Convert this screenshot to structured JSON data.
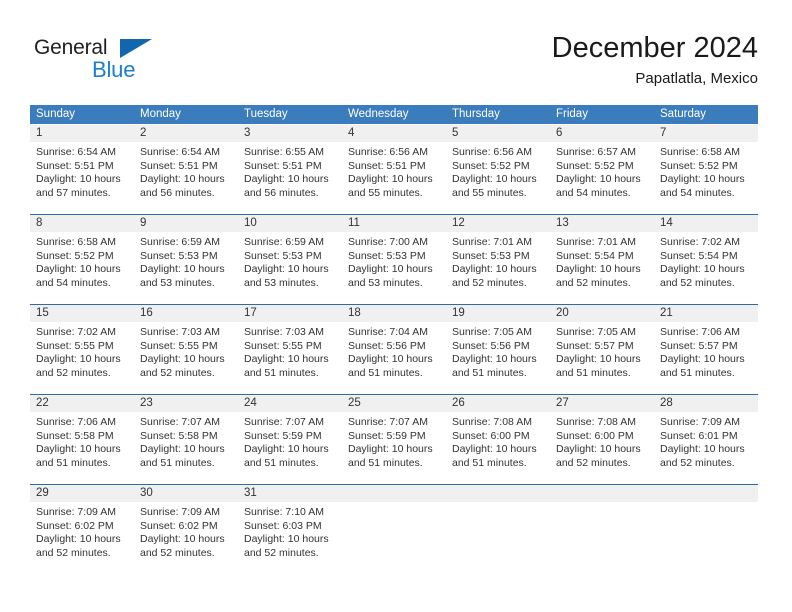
{
  "logo": {
    "word_one": "General",
    "word_two": "Blue",
    "triangle_color": "#1266ad",
    "blue_color": "#1b7fd1"
  },
  "header": {
    "title": "December 2024",
    "subtitle": "Papatlatla, Mexico"
  },
  "theme": {
    "header_blue": "#3b7cbd",
    "separator_blue": "#2d6ca8",
    "daynum_gray": "#f0f0f0"
  },
  "weekdays": [
    "Sunday",
    "Monday",
    "Tuesday",
    "Wednesday",
    "Thursday",
    "Friday",
    "Saturday"
  ],
  "weeks": [
    [
      {
        "day": "1",
        "lines": [
          "Sunrise: 6:54 AM",
          "Sunset: 5:51 PM",
          "Daylight: 10 hours",
          "and 57 minutes."
        ]
      },
      {
        "day": "2",
        "lines": [
          "Sunrise: 6:54 AM",
          "Sunset: 5:51 PM",
          "Daylight: 10 hours",
          "and 56 minutes."
        ]
      },
      {
        "day": "3",
        "lines": [
          "Sunrise: 6:55 AM",
          "Sunset: 5:51 PM",
          "Daylight: 10 hours",
          "and 56 minutes."
        ]
      },
      {
        "day": "4",
        "lines": [
          "Sunrise: 6:56 AM",
          "Sunset: 5:51 PM",
          "Daylight: 10 hours",
          "and 55 minutes."
        ]
      },
      {
        "day": "5",
        "lines": [
          "Sunrise: 6:56 AM",
          "Sunset: 5:52 PM",
          "Daylight: 10 hours",
          "and 55 minutes."
        ]
      },
      {
        "day": "6",
        "lines": [
          "Sunrise: 6:57 AM",
          "Sunset: 5:52 PM",
          "Daylight: 10 hours",
          "and 54 minutes."
        ]
      },
      {
        "day": "7",
        "lines": [
          "Sunrise: 6:58 AM",
          "Sunset: 5:52 PM",
          "Daylight: 10 hours",
          "and 54 minutes."
        ]
      }
    ],
    [
      {
        "day": "8",
        "lines": [
          "Sunrise: 6:58 AM",
          "Sunset: 5:52 PM",
          "Daylight: 10 hours",
          "and 54 minutes."
        ]
      },
      {
        "day": "9",
        "lines": [
          "Sunrise: 6:59 AM",
          "Sunset: 5:53 PM",
          "Daylight: 10 hours",
          "and 53 minutes."
        ]
      },
      {
        "day": "10",
        "lines": [
          "Sunrise: 6:59 AM",
          "Sunset: 5:53 PM",
          "Daylight: 10 hours",
          "and 53 minutes."
        ]
      },
      {
        "day": "11",
        "lines": [
          "Sunrise: 7:00 AM",
          "Sunset: 5:53 PM",
          "Daylight: 10 hours",
          "and 53 minutes."
        ]
      },
      {
        "day": "12",
        "lines": [
          "Sunrise: 7:01 AM",
          "Sunset: 5:53 PM",
          "Daylight: 10 hours",
          "and 52 minutes."
        ]
      },
      {
        "day": "13",
        "lines": [
          "Sunrise: 7:01 AM",
          "Sunset: 5:54 PM",
          "Daylight: 10 hours",
          "and 52 minutes."
        ]
      },
      {
        "day": "14",
        "lines": [
          "Sunrise: 7:02 AM",
          "Sunset: 5:54 PM",
          "Daylight: 10 hours",
          "and 52 minutes."
        ]
      }
    ],
    [
      {
        "day": "15",
        "lines": [
          "Sunrise: 7:02 AM",
          "Sunset: 5:55 PM",
          "Daylight: 10 hours",
          "and 52 minutes."
        ]
      },
      {
        "day": "16",
        "lines": [
          "Sunrise: 7:03 AM",
          "Sunset: 5:55 PM",
          "Daylight: 10 hours",
          "and 52 minutes."
        ]
      },
      {
        "day": "17",
        "lines": [
          "Sunrise: 7:03 AM",
          "Sunset: 5:55 PM",
          "Daylight: 10 hours",
          "and 51 minutes."
        ]
      },
      {
        "day": "18",
        "lines": [
          "Sunrise: 7:04 AM",
          "Sunset: 5:56 PM",
          "Daylight: 10 hours",
          "and 51 minutes."
        ]
      },
      {
        "day": "19",
        "lines": [
          "Sunrise: 7:05 AM",
          "Sunset: 5:56 PM",
          "Daylight: 10 hours",
          "and 51 minutes."
        ]
      },
      {
        "day": "20",
        "lines": [
          "Sunrise: 7:05 AM",
          "Sunset: 5:57 PM",
          "Daylight: 10 hours",
          "and 51 minutes."
        ]
      },
      {
        "day": "21",
        "lines": [
          "Sunrise: 7:06 AM",
          "Sunset: 5:57 PM",
          "Daylight: 10 hours",
          "and 51 minutes."
        ]
      }
    ],
    [
      {
        "day": "22",
        "lines": [
          "Sunrise: 7:06 AM",
          "Sunset: 5:58 PM",
          "Daylight: 10 hours",
          "and 51 minutes."
        ]
      },
      {
        "day": "23",
        "lines": [
          "Sunrise: 7:07 AM",
          "Sunset: 5:58 PM",
          "Daylight: 10 hours",
          "and 51 minutes."
        ]
      },
      {
        "day": "24",
        "lines": [
          "Sunrise: 7:07 AM",
          "Sunset: 5:59 PM",
          "Daylight: 10 hours",
          "and 51 minutes."
        ]
      },
      {
        "day": "25",
        "lines": [
          "Sunrise: 7:07 AM",
          "Sunset: 5:59 PM",
          "Daylight: 10 hours",
          "and 51 minutes."
        ]
      },
      {
        "day": "26",
        "lines": [
          "Sunrise: 7:08 AM",
          "Sunset: 6:00 PM",
          "Daylight: 10 hours",
          "and 51 minutes."
        ]
      },
      {
        "day": "27",
        "lines": [
          "Sunrise: 7:08 AM",
          "Sunset: 6:00 PM",
          "Daylight: 10 hours",
          "and 52 minutes."
        ]
      },
      {
        "day": "28",
        "lines": [
          "Sunrise: 7:09 AM",
          "Sunset: 6:01 PM",
          "Daylight: 10 hours",
          "and 52 minutes."
        ]
      }
    ],
    [
      {
        "day": "29",
        "lines": [
          "Sunrise: 7:09 AM",
          "Sunset: 6:02 PM",
          "Daylight: 10 hours",
          "and 52 minutes."
        ]
      },
      {
        "day": "30",
        "lines": [
          "Sunrise: 7:09 AM",
          "Sunset: 6:02 PM",
          "Daylight: 10 hours",
          "and 52 minutes."
        ]
      },
      {
        "day": "31",
        "lines": [
          "Sunrise: 7:10 AM",
          "Sunset: 6:03 PM",
          "Daylight: 10 hours",
          "and 52 minutes."
        ]
      },
      {
        "day": "",
        "lines": []
      },
      {
        "day": "",
        "lines": []
      },
      {
        "day": "",
        "lines": []
      },
      {
        "day": "",
        "lines": []
      }
    ]
  ]
}
